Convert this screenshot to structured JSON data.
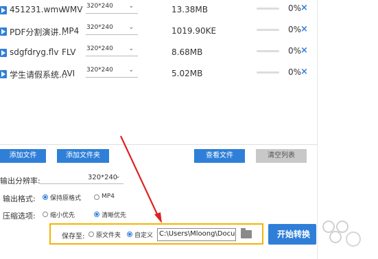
{
  "files": [
    {
      "name": "451231.wmv",
      "format": "WMV",
      "resolution": "320*240",
      "size": "13.38MB",
      "percent": "0%"
    },
    {
      "name": "PDF分割演讲...",
      "format": "MP4",
      "resolution": "320*240",
      "size": "1019.90KE",
      "percent": "0%"
    },
    {
      "name": "sdgfdryg.flv",
      "format": "FLV",
      "resolution": "320*240",
      "size": "8.68MB",
      "percent": "0%"
    },
    {
      "name": "学生请假系统...",
      "format": "AVI",
      "resolution": "320*240",
      "size": "5.02MB",
      "percent": "0%"
    }
  ],
  "icons": {
    "remove": "×",
    "caret": "⌄"
  },
  "toolbar": {
    "add_file": "添加文件",
    "add_folder": "添加文件夹",
    "view_files": "查看文件",
    "clear_list": "清空列表"
  },
  "settings": {
    "resolution_label": "输出分辨率:",
    "resolution_value": "320*240",
    "format_label": "输出格式:",
    "format_keep": "保持原格式",
    "format_mp4": "MP4",
    "compress_label": "压缩选项:",
    "compress_small": "缩小优先",
    "compress_clear": "清晰优先"
  },
  "save": {
    "label": "保存至:",
    "original_folder": "原文件夹",
    "custom": "自定义",
    "path": "C:\\Users\\Mloong\\Documents"
  },
  "start_button": "开始转换",
  "colors": {
    "accent": "#2f7fd8",
    "highlight": "#f2b400",
    "arrow": "#e02020"
  }
}
